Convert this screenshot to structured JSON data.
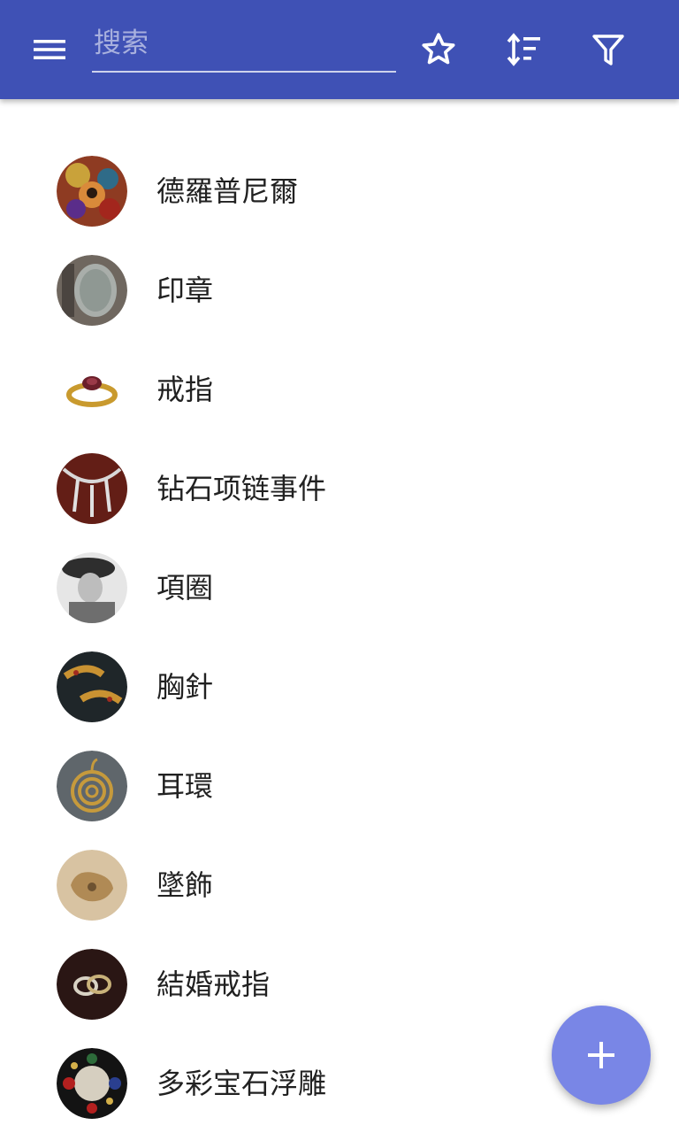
{
  "appbar": {
    "search_placeholder": "搜索",
    "icons": [
      "menu-icon",
      "star-icon",
      "sort-icon",
      "filter-icon"
    ]
  },
  "items": [
    {
      "label": "德羅普尼爾"
    },
    {
      "label": "印章"
    },
    {
      "label": "戒指"
    },
    {
      "label": "钻石项链事件"
    },
    {
      "label": "項圈"
    },
    {
      "label": "胸針"
    },
    {
      "label": "耳環"
    },
    {
      "label": "墜飾"
    },
    {
      "label": "結婚戒指"
    },
    {
      "label": "多彩宝石浮雕"
    }
  ],
  "fab": {
    "icon": "plus-icon"
  },
  "colors": {
    "primary": "#3f51b5",
    "fab": "#7986e6"
  }
}
